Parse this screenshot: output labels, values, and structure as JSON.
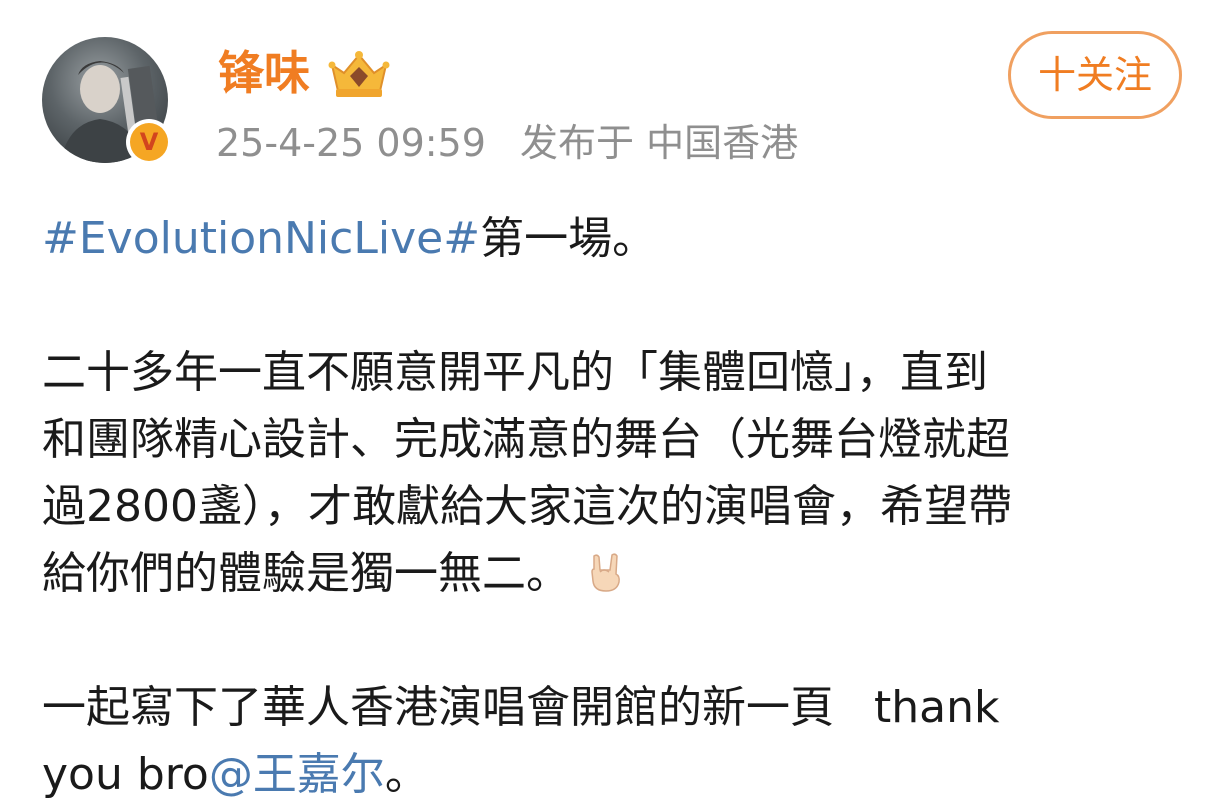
{
  "user": {
    "name": "锋味",
    "timestamp": "25-4-25 09:59",
    "location_prefix": "发布于",
    "location": "中国香港",
    "verified_mark": "V"
  },
  "follow_button": {
    "label": "十关注"
  },
  "post": {
    "hashtag": "#EvolutionNicLive#",
    "line1_rest": "第一場。",
    "para2": [
      "二十多年一直不願意開平凡的「集體回憶」，直到",
      "和團隊精心設計、完成滿意的舞台（光舞台燈就超",
      "過2800盞），才敢獻給大家這次的演唱會，希望帶",
      "給你們的體驗是獨一無二。"
    ],
    "para3_line1": "一起寫下了華人香港演唱會開館的新一頁",
    "para3_line1_tail": "thank",
    "para3_line2_prefix": "you bro",
    "mention": "@王嘉尔",
    "para3_line2_suffix": "。"
  },
  "icons": {
    "crown_badge": "crown-badge-icon",
    "emoji": "rock-hand-emoji-icon",
    "verified": "verified-v-icon"
  },
  "colors": {
    "username": "#f07d22",
    "link": "#4a7ab0",
    "meta": "#8f8f8f",
    "follow_border": "#f0a060"
  }
}
